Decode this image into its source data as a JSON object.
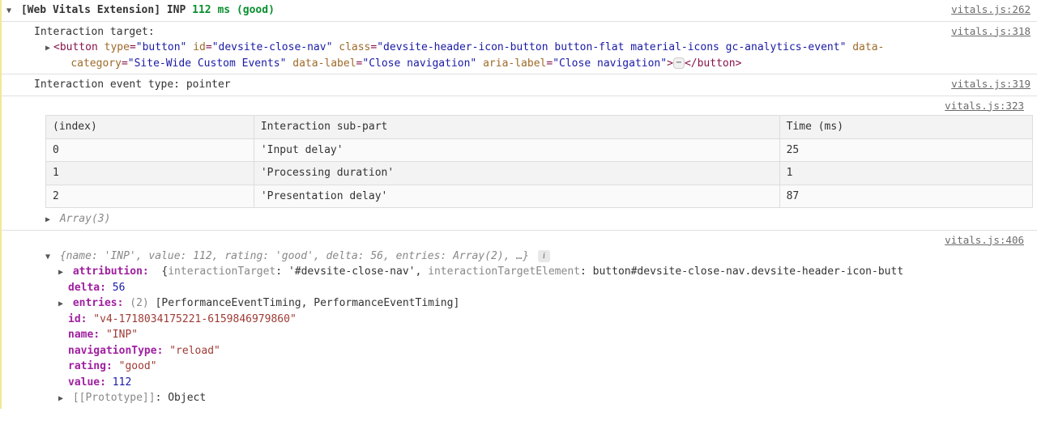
{
  "header": {
    "prefix": "[Web Vitals Extension] INP ",
    "value_text": "112 ms (good)",
    "source": "vitals.js:262"
  },
  "target": {
    "label": "Interaction target:",
    "source": "vitals.js:318",
    "dom": {
      "tag_open": "<button ",
      "attrs": [
        {
          "k": "type",
          "v": "\"button\""
        },
        {
          "k": "id",
          "v": "\"devsite-close-nav\""
        },
        {
          "k": "class",
          "v": "\"devsite-header-icon-button button-flat material-icons gc-analytics-event\""
        },
        {
          "k": "data-category",
          "v": "\"Site-Wide Custom Events\""
        },
        {
          "k": "data-label",
          "v": "\"Close navigation\""
        },
        {
          "k": "aria-label",
          "v": "\"Close navigation\""
        }
      ],
      "close_seq": "> ⋯ </button>"
    }
  },
  "event_type": {
    "text": "Interaction event type: pointer",
    "source": "vitals.js:319"
  },
  "table_block": {
    "source": "vitals.js:323",
    "headers": [
      "(index)",
      "Interaction sub-part",
      "Time (ms)"
    ],
    "rows": [
      [
        "0",
        "'Input delay'",
        "25"
      ],
      [
        "1",
        "'Processing duration'",
        "1"
      ],
      [
        "2",
        "'Presentation delay'",
        "87"
      ]
    ],
    "array_label": "Array(3)"
  },
  "object": {
    "source": "vitals.js:406",
    "preview": "{name: 'INP', value: 112, rating: 'good', delta: 56, entries: Array(2), …}",
    "attribution": {
      "key": "attribution:",
      "open": "{",
      "k1": "interactionTarget",
      "v1": ": '#devsite-close-nav', ",
      "k2": "interactionTargetElement",
      "v2": ": button#devsite-close-nav.devsite-header-icon-butt",
      "close": "}"
    },
    "delta": {
      "k": "delta:",
      "v": " 56"
    },
    "entries": {
      "k": "entries:",
      "count": " (2) ",
      "v": "[PerformanceEventTiming, PerformanceEventTiming]"
    },
    "id": {
      "k": "id:",
      "v": " \"v4-1718034175221-6159846979860\""
    },
    "name": {
      "k": "name:",
      "v": " \"INP\""
    },
    "navigationType": {
      "k": "navigationType:",
      "v": " \"reload\""
    },
    "rating": {
      "k": "rating:",
      "v": " \"good\""
    },
    "value": {
      "k": "value:",
      "v": " 112"
    },
    "prototype": {
      "k": "[[Prototype]]",
      "v": ": Object"
    }
  },
  "chart_data": {
    "type": "table",
    "title": "INP attribution breakdown",
    "columns": [
      "index",
      "Interaction sub-part",
      "Time (ms)"
    ],
    "rows": [
      [
        0,
        "Input delay",
        25
      ],
      [
        1,
        "Processing duration",
        1
      ],
      [
        2,
        "Presentation delay",
        87
      ]
    ]
  }
}
